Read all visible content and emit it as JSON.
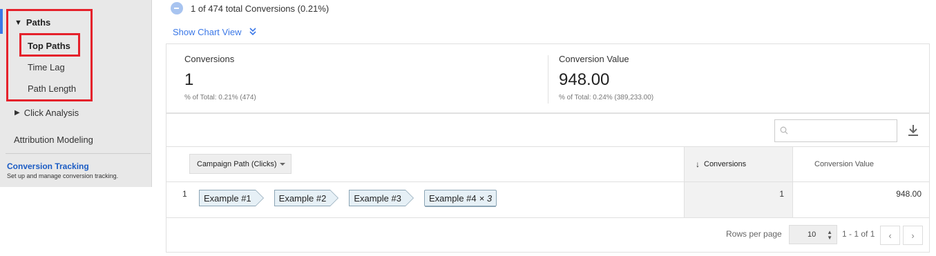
{
  "sidebar": {
    "paths_label": "Paths",
    "paths_toggle": "▼",
    "items": [
      {
        "label": "Top Paths"
      },
      {
        "label": "Time Lag"
      },
      {
        "label": "Path Length"
      }
    ],
    "click_analysis_toggle": "▶",
    "click_analysis_label": "Click Analysis",
    "attribution_label": "Attribution Modeling",
    "conversion_tracking": {
      "title": "Conversion Tracking",
      "subtitle": "Set up and manage conversion tracking."
    }
  },
  "summary": {
    "text": "1 of 474 total Conversions (0.21%)"
  },
  "show_chart": {
    "label": "Show Chart View",
    "icon": "double-chevron-down"
  },
  "metrics": [
    {
      "label": "Conversions",
      "value": "1",
      "pct": "% of Total: 0.21% (474)"
    },
    {
      "label": "Conversion Value",
      "value": "948.00",
      "pct": "% of Total: 0.24% (389,233.00)"
    }
  ],
  "table": {
    "search": {
      "placeholder": "",
      "value": ""
    },
    "dimension_select": "Campaign Path (Clicks)",
    "columns": {
      "conversions": "Conversions",
      "conversion_value": "Conversion Value",
      "sort_arrow": "↓"
    },
    "rows": [
      {
        "index": "1",
        "path": [
          "Example #1",
          "Example #2",
          "Example #3",
          "Example #4"
        ],
        "last_multiplier": "× 3",
        "conversions": "1",
        "conversion_value": "948.00"
      }
    ],
    "footer": {
      "rows_per_page_label": "Rows per page",
      "rows_per_page_value": "10",
      "page_info": "1 - 1 of 1",
      "prev": "‹",
      "next": "›"
    }
  },
  "colors": {
    "accent": "#3b78e7",
    "highlight_box": "#e5212b",
    "link": "#1a5bc4"
  }
}
